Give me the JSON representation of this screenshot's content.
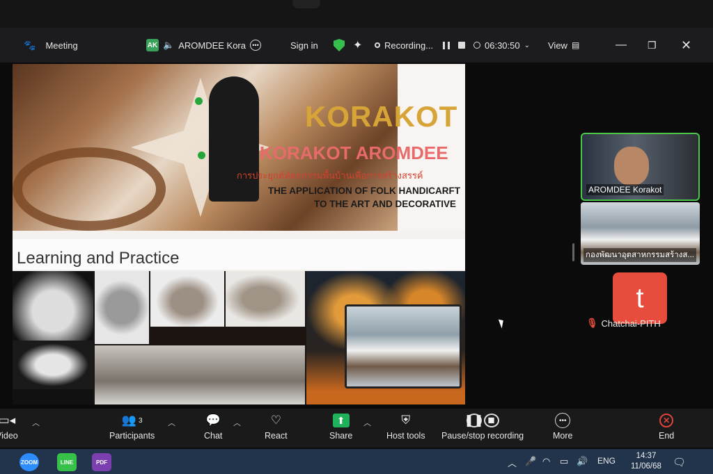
{
  "topbar": {
    "meeting_label": "Meeting",
    "host_initials": "AK",
    "host_name": "AROMDEE Kora",
    "sign_in": "Sign in",
    "recording_label": "Recording...",
    "timer": "06:30:50",
    "view_label": "View"
  },
  "slide": {
    "title_main": "KORAKOT",
    "title_name": "KORAKOT AROMDEE",
    "thai_subtitle": "การประยุกต์หัตถกรรมพื้นบ้านเพื่อการสร้างสรรค์",
    "english_line1": "THE APPLICATION OF FOLK HANDICARFT",
    "english_line2": "TO THE ART AND DECORATIVE",
    "section_heading": "Learning and Practice"
  },
  "participants": {
    "tile1_name": "AROMDEE Korakot",
    "tile2_name": "กองพัฒนาอุตสาหกรรมสร้างส...",
    "tile3_initial": "t",
    "tile3_name": "Chatchai-PITH"
  },
  "toolbar": {
    "video": "Video",
    "participants": "Participants",
    "participant_count": "3",
    "chat": "Chat",
    "react": "React",
    "share": "Share",
    "host_tools": "Host tools",
    "pause_stop": "Pause/stop recording",
    "more": "More",
    "end": "End"
  },
  "taskbar": {
    "app_zoom": "ZOOM",
    "app_line": "LINE",
    "app_pdf": "PDF",
    "language": "ENG",
    "time": "14:37",
    "date": "11/06/68"
  }
}
